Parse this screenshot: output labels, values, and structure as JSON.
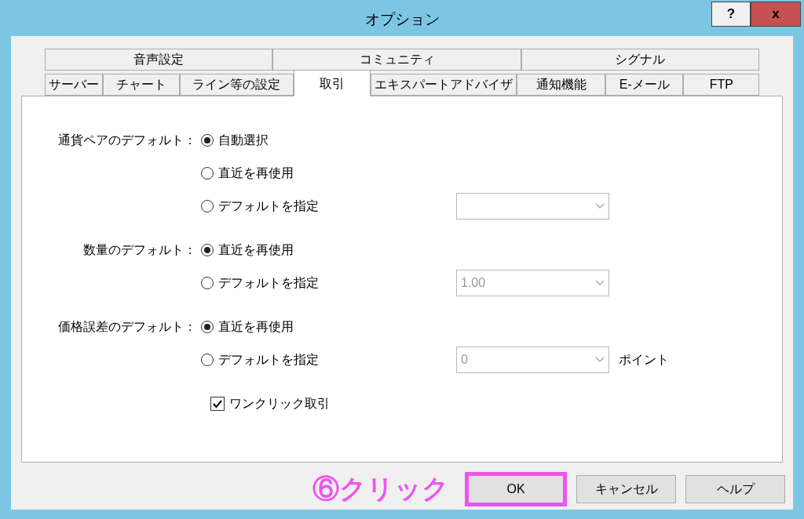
{
  "window": {
    "title": "オプション",
    "controls": [
      "?",
      "x"
    ]
  },
  "tab_rows": [
    [
      {
        "label": "音声設定",
        "selected": false
      },
      {
        "label": "コミュニティ",
        "selected": false
      },
      {
        "label": "シグナル",
        "selected": false
      }
    ],
    [
      {
        "label": "サーバー",
        "selected": false
      },
      {
        "label": "チャート",
        "selected": false
      },
      {
        "label": "ライン等の設定",
        "selected": false
      },
      {
        "label": "取引",
        "selected": true
      },
      {
        "label": "エキスパートアドバイザ",
        "selected": false
      },
      {
        "label": "通知機能",
        "selected": false
      },
      {
        "label": "E-メール",
        "selected": false
      },
      {
        "label": "FTP",
        "selected": false
      }
    ]
  ],
  "groups": [
    {
      "label": "通貨ペアのデフォルト：",
      "options": [
        {
          "label": "自動選択",
          "selected": true
        },
        {
          "label": "直近を再使用",
          "selected": false
        },
        {
          "label": "デフォルトを指定",
          "selected": false,
          "dropdown": {
            "disabled": true
          }
        }
      ]
    },
    {
      "label": "数量のデフォルト：",
      "options": [
        {
          "label": "直近を再使用",
          "selected": true
        },
        {
          "label": "デフォルトを指定",
          "selected": false,
          "dropdown": {
            "value": "1.00",
            "disabled": true
          }
        }
      ]
    },
    {
      "label": "価格誤差のデフォルト：",
      "options": [
        {
          "label": "直近を再使用",
          "selected": true
        },
        {
          "label": "デフォルトを指定",
          "selected": false,
          "dropdown": {
            "value": "0",
            "disabled": true
          },
          "suffix": "ポイント"
        }
      ]
    }
  ],
  "one_click": {
    "label": "ワンクリック取引",
    "checked": true
  },
  "annotation": {
    "text": "⑥クリック"
  },
  "buttons": [
    {
      "label": "OK",
      "highlighted": true
    },
    {
      "label": "キャンセル",
      "highlighted": false
    },
    {
      "label": "ヘルプ",
      "highlighted": false
    }
  ]
}
